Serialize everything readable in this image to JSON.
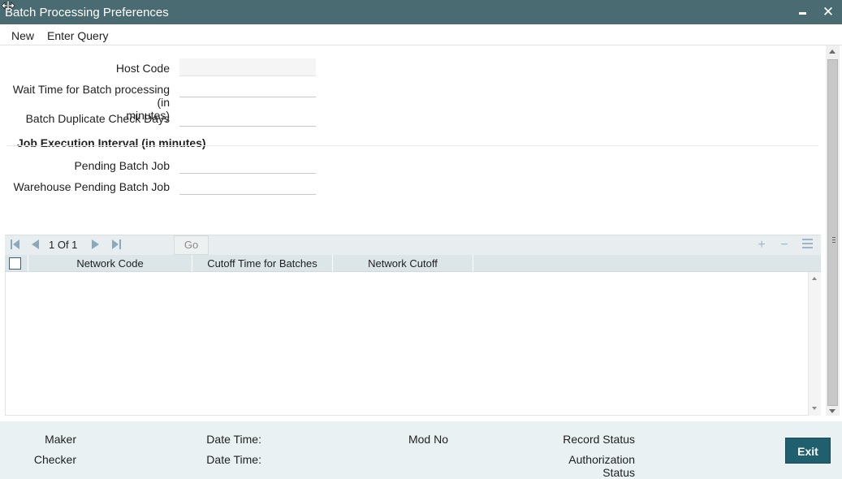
{
  "window": {
    "title": "Batch Processing Preferences",
    "minimize_icon": "minimize-icon",
    "close_icon": "close-icon",
    "close_glyph": "✕"
  },
  "menu": {
    "items": [
      "New",
      "Enter Query"
    ]
  },
  "form": {
    "host_code": {
      "label": "Host Code",
      "value": ""
    },
    "wait_time": {
      "label_line1": "Wait Time for Batch processing (in",
      "label_line2": "minutes)",
      "value": ""
    },
    "dup_check_days": {
      "label": "Batch Duplicate Check Days",
      "value": ""
    },
    "section_title": "Job Execution Interval (in minutes)",
    "pending_batch_job": {
      "label": "Pending Batch Job",
      "value": ""
    },
    "warehouse_pending_batch_job": {
      "label": "Warehouse Pending Batch Job",
      "value": ""
    }
  },
  "grid": {
    "pagination": {
      "current": 1,
      "of_label": "Of",
      "total": 1,
      "text": "1 Of 1"
    },
    "go_label": "Go",
    "add_glyph": "+",
    "remove_glyph": "−",
    "columns": [
      "Network Code",
      "Cutoff Time for Batches",
      "Network Cutoff"
    ],
    "rows": []
  },
  "footer": {
    "maker": "Maker",
    "checker": "Checker",
    "date_time_1": "Date Time:",
    "date_time_2": "Date Time:",
    "mod_no": "Mod No",
    "record_status": "Record Status",
    "authorization_status_line1": "Authorization",
    "authorization_status_line2": "Status",
    "exit_label": "Exit"
  },
  "colors": {
    "titlebar": "#4a6b72",
    "footer_bg": "#e9f1f2",
    "exit_button": "#1f5f6e",
    "grid_header": "#dce6e9"
  }
}
